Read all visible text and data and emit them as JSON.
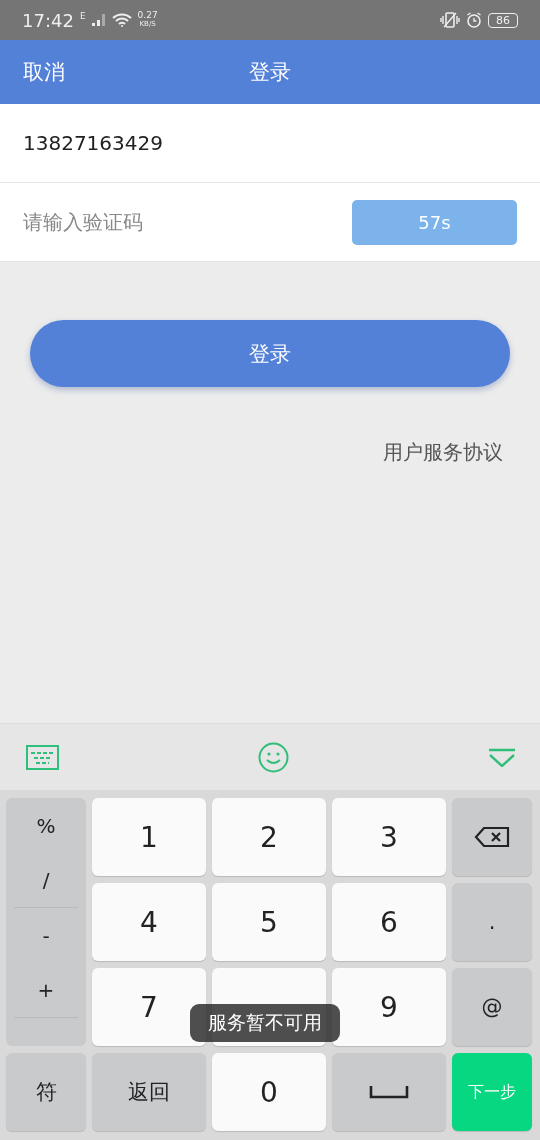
{
  "status_bar": {
    "time": "17:42",
    "network": "E",
    "speed_value": "0.27",
    "speed_unit": "KB/S",
    "battery": "86"
  },
  "header": {
    "cancel": "取消",
    "title": "登录"
  },
  "form": {
    "phone": {
      "value": "13827163429"
    },
    "code": {
      "placeholder": "请输入验证码"
    },
    "timer": {
      "label": "57s",
      "disabled": true
    }
  },
  "login_button": "登录",
  "agreement_link": "用户服务协议",
  "keyboard": {
    "symbols": [
      "%",
      "/",
      "-",
      "+"
    ],
    "keys": [
      {
        "kind": "digit",
        "label": "1"
      },
      {
        "kind": "digit",
        "label": "2"
      },
      {
        "kind": "digit",
        "label": "3"
      },
      {
        "kind": "delete"
      },
      {
        "kind": "digit",
        "label": "4"
      },
      {
        "kind": "digit",
        "label": "5"
      },
      {
        "kind": "digit",
        "label": "6"
      },
      {
        "kind": "function",
        "label": "."
      },
      {
        "kind": "digit",
        "label": "7"
      },
      {
        "kind": "digit"
      },
      {
        "kind": "digit",
        "label": "9"
      },
      {
        "kind": "function",
        "label": "@"
      },
      {
        "kind": "function",
        "label": "符"
      },
      {
        "kind": "function",
        "label": "返回"
      },
      {
        "kind": "digit",
        "label": "0"
      },
      {
        "kind": "space"
      },
      {
        "kind": "action",
        "label": "下一步"
      }
    ]
  },
  "toast": "服务暂不可用"
}
